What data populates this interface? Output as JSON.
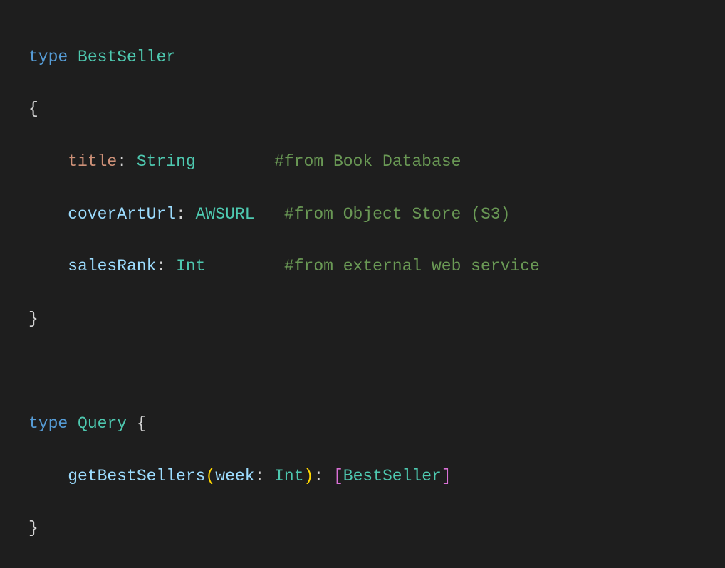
{
  "code": {
    "type1": {
      "keyword": "type",
      "name": "BestSeller",
      "open": "{",
      "fields": [
        {
          "name": "title",
          "colon": ":",
          "type": "String",
          "pad": "       ",
          "comment": "#from Book Database"
        },
        {
          "name": "coverArtUrl",
          "colon": ":",
          "type": "AWSURL",
          "pad": "  ",
          "comment": "#from Object Store (S3)"
        },
        {
          "name": "salesRank",
          "colon": ":",
          "type": "Int",
          "pad": "       ",
          "comment": "#from external web service"
        }
      ],
      "close": "}"
    },
    "type2": {
      "keyword": "type",
      "name": "Query",
      "open": "{",
      "method": {
        "name": "getBestSellers",
        "openParen": "(",
        "argName": "week",
        "argColon": ":",
        "argType": "Int",
        "closeParen": ")",
        "retColon": ":",
        "openBracket": "[",
        "retType": "BestSeller",
        "closeBracket": "]"
      },
      "close": "}"
    }
  }
}
